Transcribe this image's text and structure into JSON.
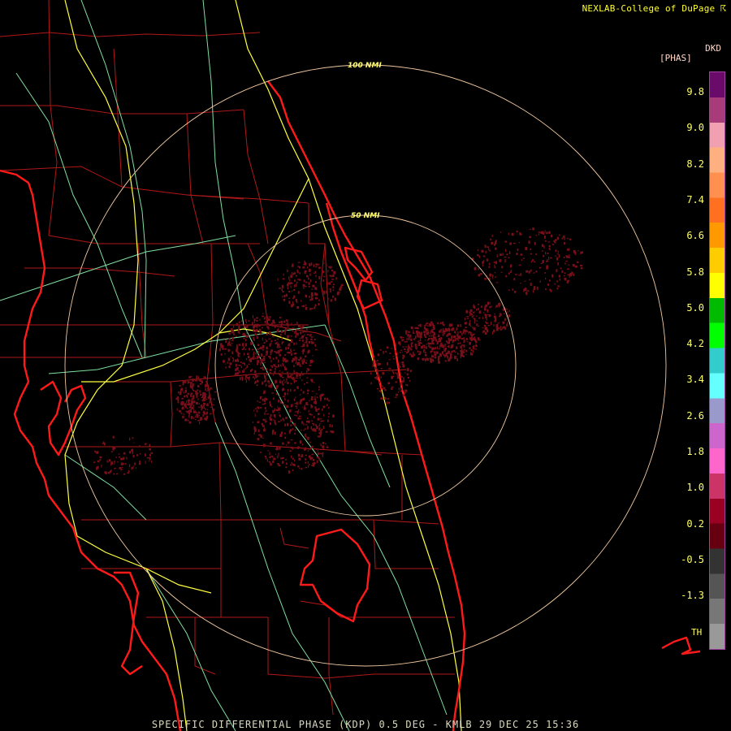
{
  "header": {
    "credit": "NEXLAB-College of DuPage ☈"
  },
  "legend": {
    "title_line1": "DKD",
    "title_line2": "[PHAS]",
    "labels": [
      "9.8",
      "9.0",
      "8.2",
      "7.4",
      "6.6",
      "5.8",
      "5.0",
      "4.2",
      "3.4",
      "2.6",
      "1.8",
      "1.0",
      "0.2",
      "-0.5",
      "-1.3"
    ],
    "label_values": [
      9.8,
      9.0,
      8.2,
      7.4,
      6.6,
      5.8,
      5.0,
      4.2,
      3.4,
      2.6,
      1.8,
      1.0,
      0.2,
      -0.5,
      -1.3
    ],
    "th_label": "TH",
    "colors": [
      "#6a0a6a",
      "#a83c7a",
      "#f0a0b0",
      "#ffb080",
      "#ff9050",
      "#ff7020",
      "#ff9900",
      "#ffcc00",
      "#ffff00",
      "#00bb00",
      "#00ff00",
      "#33cccc",
      "#66ffff",
      "#9999cc",
      "#cc66cc",
      "#ff66cc",
      "#cc3366",
      "#990022",
      "#660011",
      "#333333",
      "#555555",
      "#777777",
      "#999999"
    ]
  },
  "rings": [
    {
      "label": "100 NMI",
      "range_nmi": 100
    },
    {
      "label": "50 NMI",
      "range_nmi": 50
    }
  ],
  "footer": {
    "product": "SPECIFIC DIFFERENTIAL PHASE (KDP) 0.5 DEG - KMLB 29 DEC 25 15:36"
  },
  "colors": {
    "coast": "#ff1a1a",
    "county": "#b01818",
    "highway_yellow": "#ffff40",
    "highway_green": "#7fe0a0",
    "ring": "#f0c8a0",
    "echo": "#7a0f1a"
  }
}
